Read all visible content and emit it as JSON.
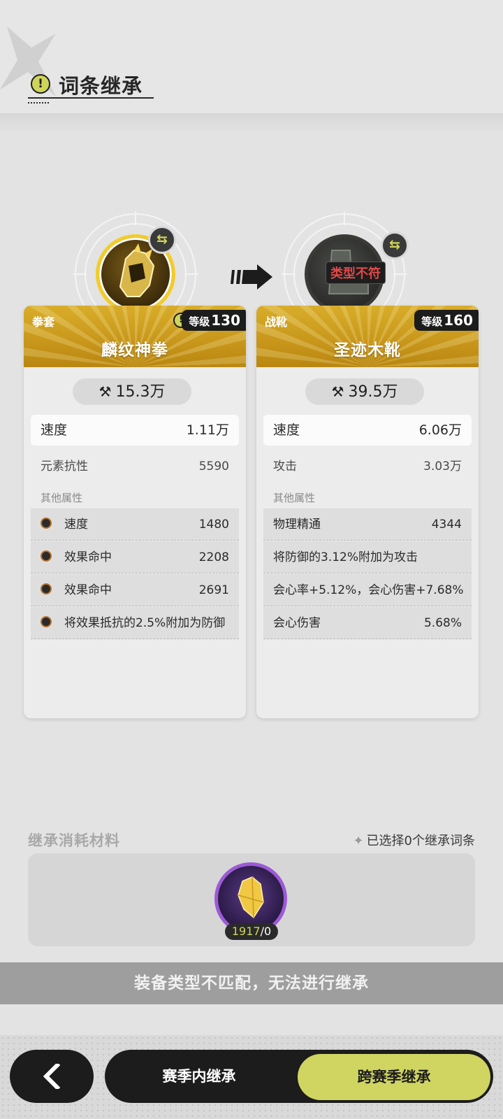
{
  "header": {
    "title": "词条继承"
  },
  "left_item": {
    "type": "拳套",
    "name": "麟纹神拳",
    "level_label": "等级",
    "level": "130",
    "power": "15.3万",
    "main_stat": {
      "name": "速度",
      "value": "1.11万"
    },
    "sub_stat": {
      "name": "元素抗性",
      "value": "5590"
    },
    "other_label": "其他属性",
    "attributes": [
      {
        "name": "速度",
        "value": "1480"
      },
      {
        "name": "效果命中",
        "value": "2208"
      },
      {
        "name": "效果命中",
        "value": "2691"
      },
      {
        "name": "将效果抵抗的2.5%附加为防御",
        "value": ""
      }
    ]
  },
  "right_item": {
    "type": "战靴",
    "name": "圣迹木靴",
    "level_label": "等级",
    "level": "160",
    "badge": "类型不符",
    "power": "39.5万",
    "main_stat": {
      "name": "速度",
      "value": "6.06万"
    },
    "sub_stat": {
      "name": "攻击",
      "value": "3.03万"
    },
    "other_label": "其他属性",
    "attributes": [
      {
        "name": "物理精通",
        "value": "4344"
      },
      {
        "name": "将防御的3.12%附加为攻击",
        "value": ""
      },
      {
        "name": "会心率+5.12%，会心伤害+7.68%",
        "value": ""
      },
      {
        "name": "会心伤害",
        "value": "5.68%"
      }
    ]
  },
  "materials": {
    "title": "继承消耗材料",
    "selected_text": "已选择0个继承词条",
    "owned": "1917",
    "required": "/0"
  },
  "notice": "装备类型不匹配，无法进行继承",
  "tabs": {
    "in_season": "赛季内继承",
    "cross_season": "跨赛季继承"
  },
  "colors": {
    "gold": "#c8961a",
    "accent": "#cfd560",
    "mismatch": "#e34848",
    "purple": "#9c5ad6"
  },
  "icons": [
    "warning-icon",
    "swap-icon",
    "arrow-right-icon",
    "power-icon",
    "back-icon",
    "crystal-icon"
  ]
}
